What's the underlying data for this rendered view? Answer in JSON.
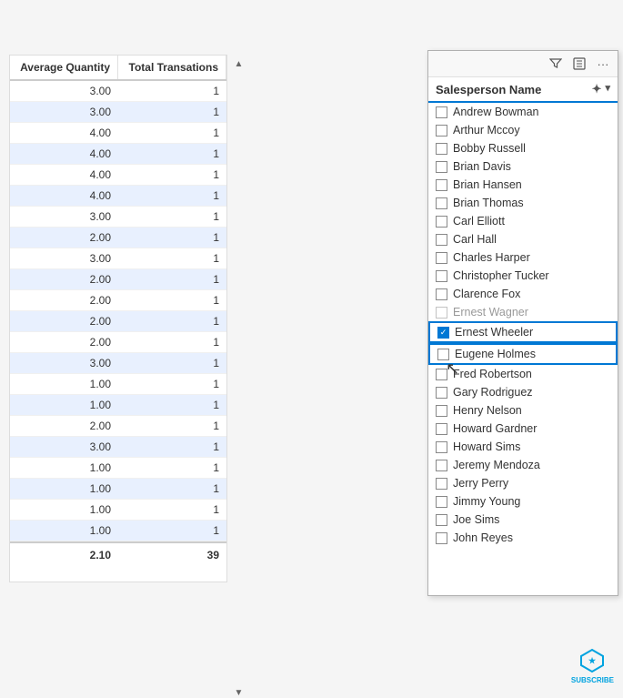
{
  "table": {
    "headers": {
      "avg_qty": "Average Quantity",
      "total_trans": "Total Transations"
    },
    "rows": [
      {
        "avg": "3.00",
        "total": "1",
        "highlighted": false
      },
      {
        "avg": "3.00",
        "total": "1",
        "highlighted": true
      },
      {
        "avg": "4.00",
        "total": "1",
        "highlighted": false
      },
      {
        "avg": "4.00",
        "total": "1",
        "highlighted": true
      },
      {
        "avg": "4.00",
        "total": "1",
        "highlighted": false
      },
      {
        "avg": "4.00",
        "total": "1",
        "highlighted": true
      },
      {
        "avg": "3.00",
        "total": "1",
        "highlighted": false
      },
      {
        "avg": "2.00",
        "total": "1",
        "highlighted": true
      },
      {
        "avg": "3.00",
        "total": "1",
        "highlighted": false
      },
      {
        "avg": "2.00",
        "total": "1",
        "highlighted": true
      },
      {
        "avg": "2.00",
        "total": "1",
        "highlighted": false
      },
      {
        "avg": "2.00",
        "total": "1",
        "highlighted": true
      },
      {
        "avg": "2.00",
        "total": "1",
        "highlighted": false
      },
      {
        "avg": "3.00",
        "total": "1",
        "highlighted": true
      },
      {
        "avg": "1.00",
        "total": "1",
        "highlighted": false
      },
      {
        "avg": "1.00",
        "total": "1",
        "highlighted": true
      },
      {
        "avg": "2.00",
        "total": "1",
        "highlighted": false
      },
      {
        "avg": "3.00",
        "total": "1",
        "highlighted": true
      },
      {
        "avg": "1.00",
        "total": "1",
        "highlighted": false
      },
      {
        "avg": "1.00",
        "total": "1",
        "highlighted": true
      },
      {
        "avg": "1.00",
        "total": "1",
        "highlighted": false
      },
      {
        "avg": "1.00",
        "total": "1",
        "highlighted": true
      }
    ],
    "footer": {
      "avg": "2.10",
      "total": "39"
    }
  },
  "filter_panel": {
    "toolbar_icons": [
      "filter-icon",
      "expand-icon",
      "more-icon"
    ],
    "header_label": "Salesperson Name",
    "header_icons": [
      "eraser-icon",
      "chevron-down-icon"
    ],
    "items": [
      {
        "name": "Andrew Bowman",
        "checked": false,
        "highlighted": false
      },
      {
        "name": "Arthur Mccoy",
        "checked": false,
        "highlighted": false
      },
      {
        "name": "Bobby Russell",
        "checked": false,
        "highlighted": false
      },
      {
        "name": "Brian Davis",
        "checked": false,
        "highlighted": false
      },
      {
        "name": "Brian Hansen",
        "checked": false,
        "highlighted": false
      },
      {
        "name": "Brian Thomas",
        "checked": false,
        "highlighted": false
      },
      {
        "name": "Carl Elliott",
        "checked": false,
        "highlighted": false
      },
      {
        "name": "Carl Hall",
        "checked": false,
        "highlighted": false
      },
      {
        "name": "Charles Harper",
        "checked": false,
        "highlighted": false
      },
      {
        "name": "Christopher Tucker",
        "checked": false,
        "highlighted": false
      },
      {
        "name": "Clarence Fox",
        "checked": false,
        "highlighted": false
      },
      {
        "name": "Ernest Wagner",
        "checked": false,
        "highlighted": false,
        "partially_visible": true
      },
      {
        "name": "Ernest Wheeler",
        "checked": true,
        "highlighted": true,
        "active": true
      },
      {
        "name": "Eugene Holmes",
        "checked": false,
        "highlighted": true,
        "active": true
      },
      {
        "name": "Fred Robertson",
        "checked": false,
        "highlighted": false
      },
      {
        "name": "Gary Rodriguez",
        "checked": false,
        "highlighted": false
      },
      {
        "name": "Henry Nelson",
        "checked": false,
        "highlighted": false
      },
      {
        "name": "Howard Gardner",
        "checked": false,
        "highlighted": false
      },
      {
        "name": "Howard Sims",
        "checked": false,
        "highlighted": false
      },
      {
        "name": "Jeremy Mendoza",
        "checked": false,
        "highlighted": false
      },
      {
        "name": "Jerry Perry",
        "checked": false,
        "highlighted": false
      },
      {
        "name": "Jimmy Young",
        "checked": false,
        "highlighted": false
      },
      {
        "name": "Joe Sims",
        "checked": false,
        "highlighted": false
      },
      {
        "name": "John Reyes",
        "checked": false,
        "highlighted": false
      }
    ]
  },
  "subscribe": {
    "label": "SUBSCRIBE"
  }
}
